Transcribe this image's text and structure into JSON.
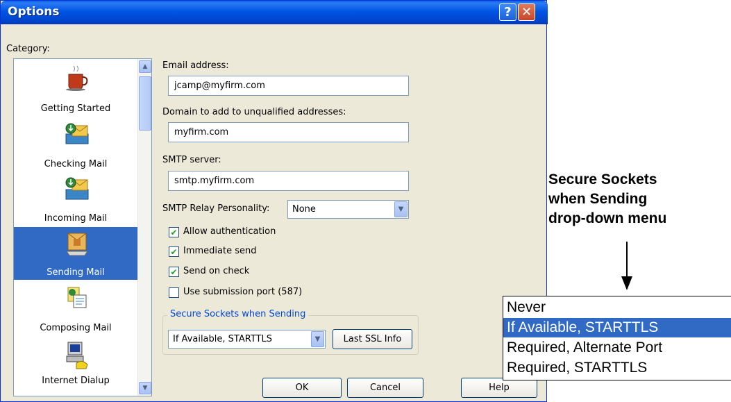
{
  "window": {
    "title": "Options",
    "help_glyph": "?",
    "close_glyph": "✕"
  },
  "category": {
    "label": "Category:",
    "items": [
      {
        "label": "Getting Started",
        "icon": "coffee-cup-icon"
      },
      {
        "label": "Checking Mail",
        "icon": "download-mail-icon"
      },
      {
        "label": "Incoming Mail",
        "icon": "incoming-mail-icon"
      },
      {
        "label": "Sending Mail",
        "icon": "sending-mail-icon",
        "selected": true
      },
      {
        "label": "Composing Mail",
        "icon": "composing-mail-icon"
      },
      {
        "label": "Internet Dialup",
        "icon": "dialup-computer-icon"
      }
    ]
  },
  "fields": {
    "email_label": "Email address:",
    "email_value": "jcamp@myfirm.com",
    "domain_label": "Domain to add to unqualified addresses:",
    "domain_value": "myfirm.com",
    "smtp_label": "SMTP server:",
    "smtp_value": "smtp.myfirm.com",
    "relay_label": "SMTP Relay Personality:",
    "relay_value": "None"
  },
  "checkboxes": [
    {
      "label": "Allow authentication",
      "checked": true
    },
    {
      "label": "Immediate send",
      "checked": true
    },
    {
      "label": "Send on check",
      "checked": true
    },
    {
      "label": "Use submission port (587)",
      "checked": false
    }
  ],
  "ssl": {
    "group_label": "Secure Sockets when Sending",
    "value": "If Available, STARTTLS",
    "last_ssl_button": "Last SSL Info"
  },
  "buttons": {
    "ok": "OK",
    "cancel": "Cancel",
    "help": "Help"
  },
  "annotation": {
    "lines": [
      "Secure Sockets",
      "when Sending",
      "drop-down menu"
    ]
  },
  "dropdown_options": [
    {
      "label": "Never"
    },
    {
      "label": "If Available, STARTTLS",
      "selected": true
    },
    {
      "label": "Required, Alternate Port"
    },
    {
      "label": "Required, STARTTLS"
    }
  ],
  "colors": {
    "selection": "#316ac5",
    "titlebar": "#0055e5",
    "dialog_bg": "#ece9d8"
  }
}
